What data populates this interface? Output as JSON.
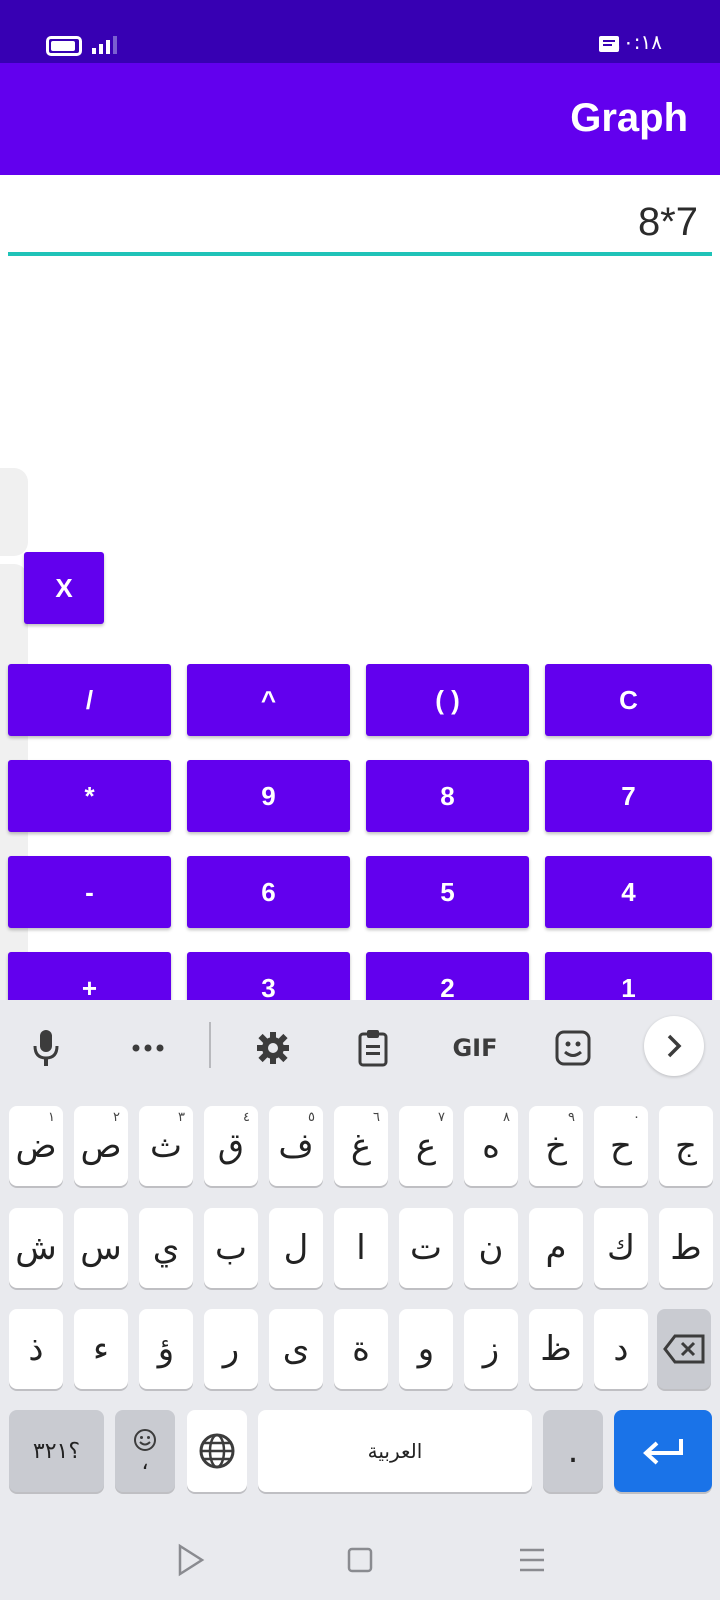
{
  "status_bar": {
    "time": "١٠:١٨"
  },
  "app_bar": {
    "title": "Graph"
  },
  "expression": {
    "value": "8*7"
  },
  "buttons": {
    "x": "X",
    "row1": [
      "/",
      "^",
      "( )",
      "C"
    ],
    "row2": [
      "*",
      "9",
      "8",
      "7"
    ],
    "row3": [
      "-",
      "6",
      "5",
      "4"
    ],
    "row4": [
      "+",
      "3",
      "2",
      "1"
    ]
  },
  "keyboard": {
    "toolbar": {
      "gif": "GIF"
    },
    "row1": [
      "ض",
      "ص",
      "ث",
      "ق",
      "ف",
      "غ",
      "ع",
      "ه",
      "خ",
      "ح",
      "ج"
    ],
    "row1_hints": [
      "١",
      "٢",
      "٣",
      "٤",
      "٥",
      "٦",
      "٧",
      "٨",
      "٩",
      "٠",
      ""
    ],
    "row2": [
      "ش",
      "س",
      "ي",
      "ب",
      "ل",
      "ا",
      "ت",
      "ن",
      "م",
      "ك",
      "ط"
    ],
    "row3": [
      "ذ",
      "ء",
      "ؤ",
      "ر",
      "ى",
      "ة",
      "و",
      "ز",
      "ظ",
      "د"
    ],
    "symbols_key": "؟٣٢١",
    "comma_key": "،",
    "space_label": "العربية",
    "period_key": "."
  },
  "colors": {
    "primary": "#6200ee",
    "status": "#3700b3",
    "accent": "#1fc3b8",
    "enter": "#1a73e8"
  }
}
